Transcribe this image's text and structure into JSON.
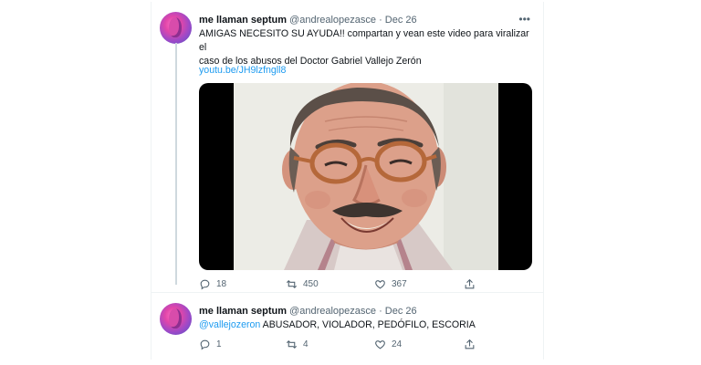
{
  "tweets": [
    {
      "display_name": "me llaman septum",
      "handle": "@andrealopezasce",
      "separator": "·",
      "date": "Dec 26",
      "more": "•••",
      "text_line1": "AMIGAS NECESITO SU AYUDA!! compartan y vean este video para viralizar el",
      "text_line2": "caso de los abusos del Doctor Gabriel Vallejo Zerón",
      "link": "youtu.be/JH9lzfngll8",
      "replies": "18",
      "retweets": "450",
      "likes": "367"
    },
    {
      "display_name": "me llaman septum",
      "handle": "@andrealopezasce",
      "separator": "·",
      "date": "Dec 26",
      "mention": "@vallejozeron",
      "text": " ABUSADOR, VIOLADOR, PEDÓFILO, ESCORIA",
      "replies": "1",
      "retweets": "4",
      "likes": "24"
    }
  ],
  "icons": {
    "reply": "reply-icon",
    "retweet": "retweet-icon",
    "like": "heart-icon",
    "share": "share-icon",
    "more": "more-icon"
  },
  "colors": {
    "link": "#1d9bf0",
    "secondary_text": "#536471",
    "thread_line": "#cfd9de"
  }
}
